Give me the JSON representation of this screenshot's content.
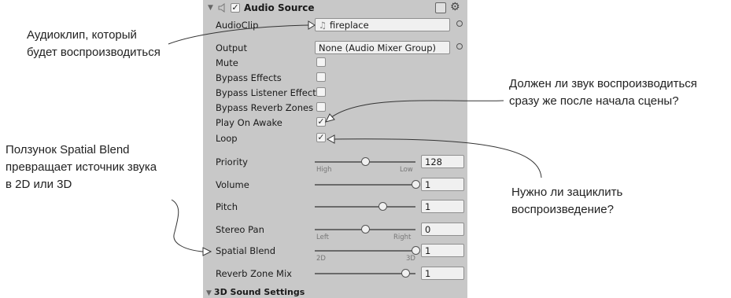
{
  "component": {
    "title": "Audio Source",
    "enabled_check": "✓",
    "footer": "3D Sound Settings"
  },
  "properties": {
    "audioclip": {
      "label": "AudioClip",
      "value": "fireplace"
    },
    "output": {
      "label": "Output",
      "value": "None (Audio Mixer Group)"
    },
    "mute": {
      "label": "Mute",
      "checked": false
    },
    "bypass_effects": {
      "label": "Bypass Effects",
      "checked": false
    },
    "bypass_listener": {
      "label": "Bypass Listener Effect",
      "checked": false
    },
    "bypass_reverb": {
      "label": "Bypass Reverb Zones",
      "checked": false
    },
    "play_on_awake": {
      "label": "Play On Awake",
      "checked": true,
      "mark": "✓"
    },
    "loop": {
      "label": "Loop",
      "checked": true,
      "mark": "✓"
    },
    "priority": {
      "label": "Priority",
      "value": "128",
      "level": 0.5,
      "min_label": "High",
      "max_label": "Low"
    },
    "volume": {
      "label": "Volume",
      "value": "1",
      "level": 1.0
    },
    "pitch": {
      "label": "Pitch",
      "value": "1",
      "level": 0.67
    },
    "stereo_pan": {
      "label": "Stereo Pan",
      "value": "0",
      "level": 0.5,
      "min_label": "Left",
      "max_label": "Right"
    },
    "spatial_blend": {
      "label": "Spatial Blend",
      "value": "1",
      "level": 1.0,
      "min_label": "2D",
      "max_label": "3D"
    },
    "reverb_zone_mix": {
      "label": "Reverb Zone Mix",
      "value": "1",
      "level": 0.9
    }
  },
  "annotations": {
    "audioclip_1": "Аудиоклип, который",
    "audioclip_2": "будет воспроизводиться",
    "play_1": "Должен ли звук воспроизводиться",
    "play_2": "сразу же после начала сцены?",
    "spatial_1": "Ползунок Spatial Blend",
    "spatial_2": "превращает источник звука",
    "spatial_3": "в 2D или 3D",
    "loop_1": "Нужно ли зациклить",
    "loop_2": "воспроизведение?"
  }
}
